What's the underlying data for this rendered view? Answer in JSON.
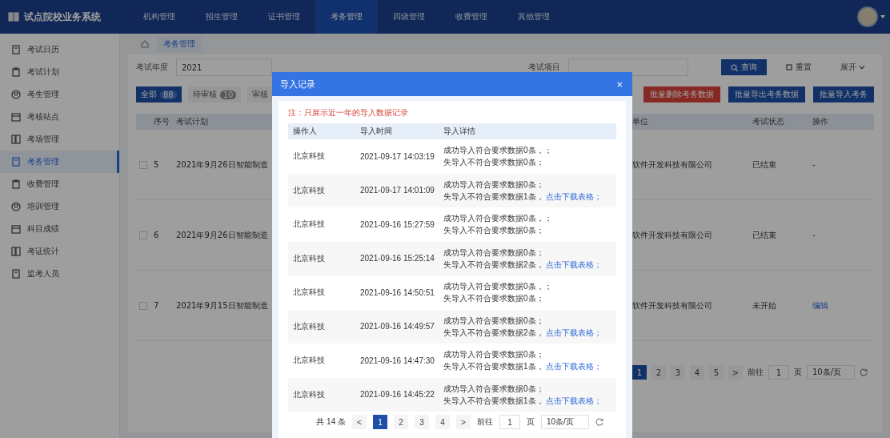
{
  "app": {
    "title": "试点院校业务系统"
  },
  "top_nav": [
    {
      "label": "机构管理",
      "selected": false
    },
    {
      "label": "招生管理",
      "selected": false
    },
    {
      "label": "证书管理",
      "selected": false
    },
    {
      "label": "考务管理",
      "selected": true
    },
    {
      "label": "四级管理",
      "selected": false
    },
    {
      "label": "收费管理",
      "selected": false
    },
    {
      "label": "其他管理",
      "selected": false
    }
  ],
  "sidebar": {
    "items": [
      {
        "label": "考试日历",
        "selected": false
      },
      {
        "label": "考试计划",
        "selected": false
      },
      {
        "label": "考生管理",
        "selected": false
      },
      {
        "label": "考核站点",
        "selected": false
      },
      {
        "label": "考场管理",
        "selected": false
      },
      {
        "label": "考务管理",
        "selected": true
      },
      {
        "label": "收费管理",
        "selected": false
      },
      {
        "label": "培训管理",
        "selected": false
      },
      {
        "label": "科目成绩",
        "selected": false
      },
      {
        "label": "考证统计",
        "selected": false
      },
      {
        "label": "监考人员",
        "selected": false
      }
    ]
  },
  "breadcrumb": {
    "tags": [
      {
        "label": "考务管理",
        "selected": true
      }
    ]
  },
  "filters": [
    {
      "label": "考试年度",
      "value": "2021"
    },
    {
      "label": "考试项目"
    }
  ],
  "search_buttons": [
    {
      "label": "查询",
      "kind": "primary"
    },
    {
      "label": "重置",
      "kind": "plain"
    },
    {
      "label": "展开",
      "kind": "dropdown"
    }
  ],
  "status_tabs": [
    {
      "label": "全部",
      "count": "88",
      "selected": true
    },
    {
      "label": "待审核",
      "count": "10",
      "selected": false
    },
    {
      "label": "审核",
      "selected": false
    }
  ],
  "actions": [
    {
      "label": "批量删除考务数据",
      "kind": "danger"
    },
    {
      "label": "批量导出考务数据",
      "kind": "primary"
    },
    {
      "label": "批量导入考务",
      "kind": "dropdown"
    }
  ],
  "table": {
    "columns": [
      "序号",
      "考试计划",
      "单位",
      "考试状态",
      "操作"
    ],
    "rows": [
      {
        "checked": false,
        "index": "5",
        "plan": "2021年9月26日智能制造",
        "org": "软件开发科技有限公司",
        "status": "已结束",
        "action": "-",
        "kind": "text"
      },
      {
        "checked": false,
        "index": "6",
        "plan": "2021年9月26日智能制造",
        "org": "软件开发科技有限公司",
        "status": "已结束",
        "action": "-",
        "kind": "text"
      },
      {
        "checked": false,
        "index": "7",
        "plan": "2021年9月15日智能制造",
        "org": "软件开发科技有限公司",
        "status": "未开始",
        "action": "编辑",
        "kind": "link"
      }
    ]
  },
  "pagination": {
    "pages": [
      {
        "label": "1",
        "selected": true
      },
      {
        "label": "2",
        "selected": false
      },
      {
        "label": "3",
        "selected": false
      },
      {
        "label": "4",
        "selected": false
      },
      {
        "label": "5",
        "selected": false
      }
    ],
    "next": ">",
    "goto_label": "前往",
    "goto_value": "1",
    "page_unit": "页",
    "page_size": "10条/页"
  },
  "dialog": {
    "title": "导入记录",
    "close": "×",
    "note": "注：只展示近一年的导入数据记录",
    "columns": [
      "操作人",
      "导入时间",
      "导入详情"
    ],
    "rows": [
      {
        "operator": "北京科技",
        "time": "2021-09-17 14:03:19",
        "lines": [
          "成功导入符合要求数据0条，；",
          "失导入不符合要求数据0条；"
        ]
      },
      {
        "operator": "北京科技",
        "time": "2021-09-17 14:01:09",
        "lines": [
          "成功导入符合要求数据0条；",
          "失导入不符合要求数据1条，"
        ],
        "link": "点击下载表格；"
      },
      {
        "operator": "北京科技",
        "time": "2021-09-16 15:27:59",
        "lines": [
          "成功导入符合要求数据0条，；",
          "失导入不符合要求数据0条；"
        ]
      },
      {
        "operator": "北京科技",
        "time": "2021-09-16 15:25:14",
        "lines": [
          "成功导入符合要求数据0条；",
          "失导入不符合要求数据2条，"
        ],
        "link": "点击下载表格；"
      },
      {
        "operator": "北京科技",
        "time": "2021-09-16 14:50:51",
        "lines": [
          "成功导入符合要求数据0条，；",
          "失导入不符合要求数据0条；"
        ]
      },
      {
        "operator": "北京科技",
        "time": "2021-09-16 14:49:57",
        "lines": [
          "成功导入符合要求数据0条；",
          "失导入不符合要求数据2条，"
        ],
        "link": "点击下载表格；"
      },
      {
        "operator": "北京科技",
        "time": "2021-09-16 14:47:30",
        "lines": [
          "成功导入符合要求数据0条；",
          "失导入不符合要求数据1条，"
        ],
        "link": "点击下载表格；"
      },
      {
        "operator": "北京科技",
        "time": "2021-09-16 14:45:22",
        "lines": [
          "成功导入符合要求数据0条；",
          "失导入不符合要求数据1条，"
        ],
        "link": "点击下载表格；"
      }
    ],
    "pagination": {
      "total": "共 14 条",
      "prev": "<",
      "pages": [
        {
          "label": "1",
          "selected": true
        },
        {
          "label": "2",
          "selected": false
        },
        {
          "label": "3",
          "selected": false
        },
        {
          "label": "4",
          "selected": false
        }
      ],
      "next": ">",
      "goto_label": "前往",
      "goto_value": "1",
      "page_unit": "页",
      "page_size": "10条/页"
    }
  }
}
